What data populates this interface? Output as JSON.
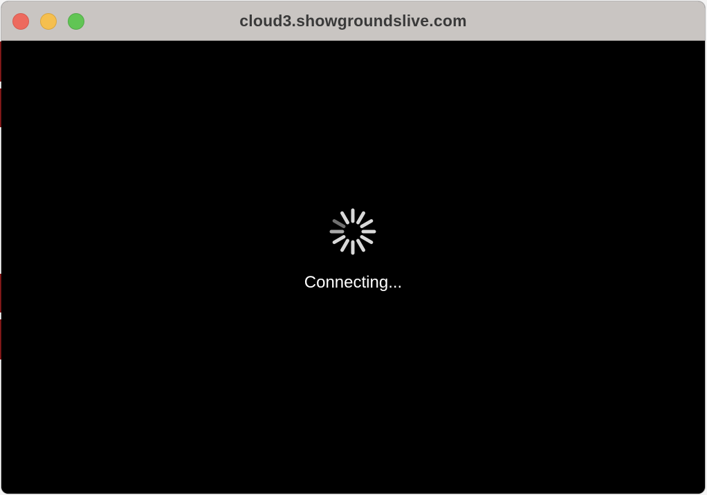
{
  "window": {
    "title": "cloud3.showgroundslive.com",
    "controls": {
      "close_color": "#ed6a5e",
      "minimize_color": "#f5bf4f",
      "zoom_color": "#61c554"
    }
  },
  "main": {
    "spinner_icon": "loading-spinner-icon",
    "status_text": "Connecting..."
  }
}
